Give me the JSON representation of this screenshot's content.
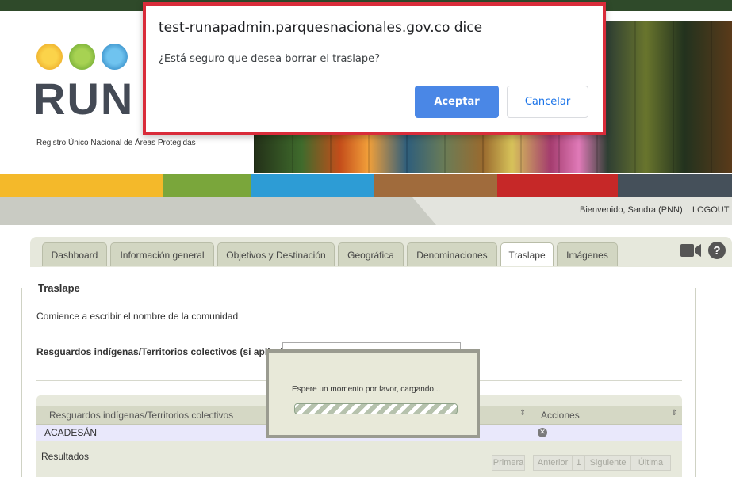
{
  "header": {
    "logo_text": "RUN",
    "logo_subtitle": "Registro Único Nacional de Áreas Protegidas",
    "welcome": "Bienvenido, Sandra (PNN)",
    "logout": "LOGOUT",
    "color_bar": [
      "#f4b92a",
      "#7aa63b",
      "#2d9cd5",
      "#a06b3c",
      "#c62828",
      "#45505a"
    ]
  },
  "tabs": [
    {
      "label": "Dashboard"
    },
    {
      "label": "Información general"
    },
    {
      "label": "Objetivos y Destinación"
    },
    {
      "label": "Geográfica"
    },
    {
      "label": "Denominaciones"
    },
    {
      "label": "Traslape"
    },
    {
      "label": "Imágenes"
    }
  ],
  "icons": {
    "camera": "video-camera-icon",
    "help": "help-icon",
    "help_glyph": "?"
  },
  "section": {
    "legend": "Traslape",
    "instruction": "Comience a escribir el nombre de la comunidad",
    "field_label": "Resguardos indígenas/Territorios colectivos (si aplica)",
    "field_value": ""
  },
  "grid": {
    "columns": [
      "Resguardos indígenas/Territorios colectivos",
      "Acciones"
    ],
    "rows": [
      {
        "name": "ACADESÁN"
      }
    ],
    "footer": "Resultados",
    "pager": {
      "first": "Primera",
      "prev": "Anterior",
      "page": "1",
      "next": "Siguiente",
      "last": "Última"
    }
  },
  "loading": {
    "text": "Espere un momento por favor, cargando..."
  },
  "dialog": {
    "title": "test-runapadmin.parquesnacionales.gov.co dice",
    "message": "¿Está seguro que desea borrar el traslape?",
    "accept": "Aceptar",
    "cancel": "Cancelar",
    "accent": "#4a87e6",
    "highlight": "#d92c3a"
  }
}
